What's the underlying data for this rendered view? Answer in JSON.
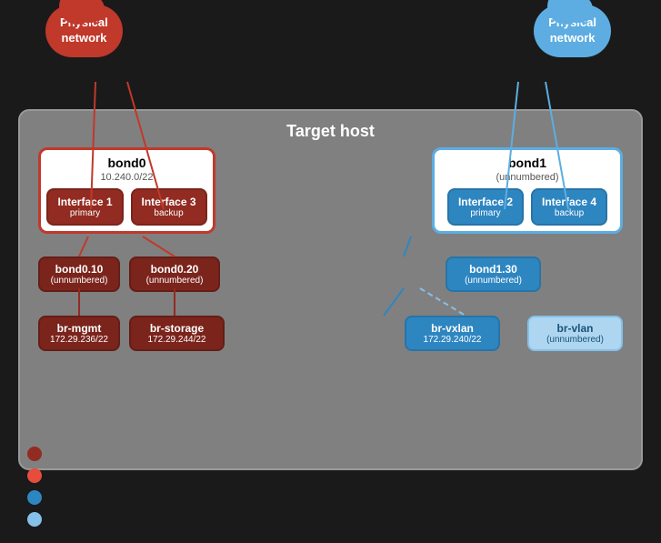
{
  "clouds": {
    "left": {
      "label": "Physical\nnetwork",
      "color": "red"
    },
    "right": {
      "label": "Physical\nnetwork",
      "color": "blue"
    }
  },
  "targetHost": {
    "title": "Target host",
    "leftBond": {
      "name": "bond0",
      "subtitle": "10.240.0/22",
      "interface1": {
        "label": "Interface 1",
        "sub": "primary"
      },
      "interface2": {
        "label": "Interface 3",
        "sub": "backup"
      }
    },
    "rightBond": {
      "name": "bond1",
      "subtitle": "(unnumbered)",
      "interface1": {
        "label": "Interface 2",
        "sub": "primary"
      },
      "interface2": {
        "label": "Interface 4",
        "sub": "backup"
      }
    },
    "leftSubnets": [
      {
        "id": "bond010",
        "name": "bond0.10",
        "sub": "(unnumbered)"
      },
      {
        "id": "bond020",
        "name": "bond0.20",
        "sub": "(unnumbered)"
      }
    ],
    "leftBridges": [
      {
        "id": "br-mgmt",
        "name": "br-mgmt",
        "sub": "172.29.236/22"
      },
      {
        "id": "br-storage",
        "name": "br-storage",
        "sub": "172.29.244/22"
      }
    ],
    "rightSubnets": [
      {
        "id": "bond130",
        "name": "bond1.30",
        "sub": "(unnumbered)"
      }
    ],
    "rightBridges": [
      {
        "id": "br-vxlan",
        "name": "br-vxlan",
        "sub": "172.29.240/22",
        "style": "blue"
      },
      {
        "id": "br-vlan",
        "name": "br-vlan",
        "sub": "(unnumbered)",
        "style": "light-blue"
      }
    ]
  },
  "legend": [
    {
      "color": "#922b21",
      "label": ""
    },
    {
      "color": "#e74c3c",
      "label": ""
    },
    {
      "color": "#2e86c1",
      "label": ""
    },
    {
      "color": "#85c1e9",
      "label": ""
    }
  ]
}
